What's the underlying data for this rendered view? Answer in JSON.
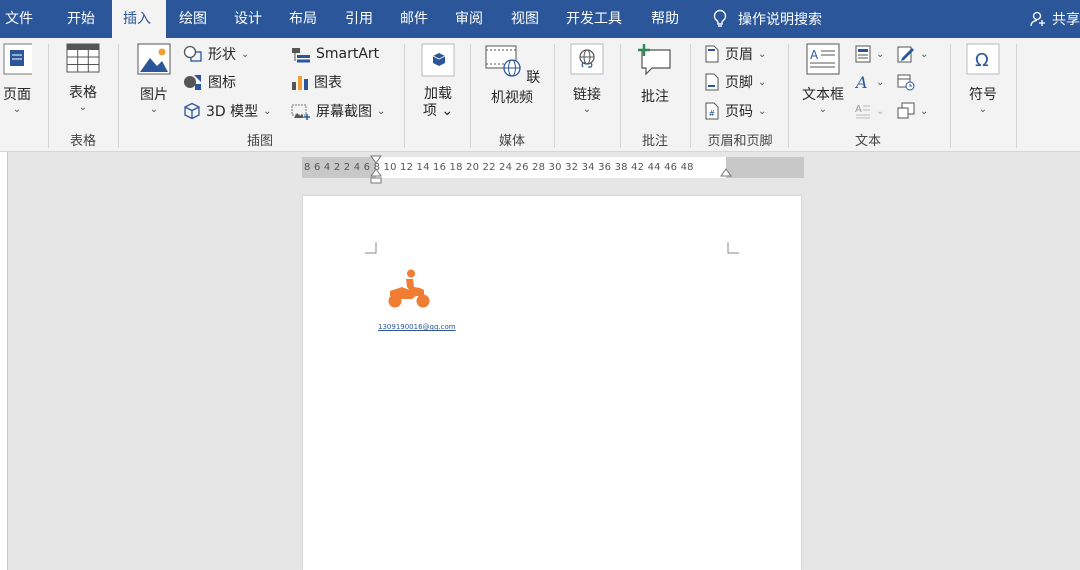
{
  "menu": {
    "tabs": [
      "文件",
      "开始",
      "插入",
      "绘图",
      "设计",
      "布局",
      "引用",
      "邮件",
      "审阅",
      "视图",
      "开发工具",
      "帮助"
    ],
    "active_tab": "插入",
    "search_label": "操作说明搜索",
    "share_label": "共享"
  },
  "ribbon": {
    "groups": {
      "page": {
        "button": "页面"
      },
      "table": {
        "button": "表格",
        "label": "表格"
      },
      "illustrations": {
        "label": "插图",
        "picture": "图片",
        "shapes": "形状",
        "icons": "图标",
        "model3d": "3D 模型",
        "smartart": "SmartArt",
        "chart": "图表",
        "screenshot": "屏幕截图"
      },
      "addins": {
        "button_line1": "加载",
        "button_line2": "项"
      },
      "media": {
        "button": "联机视频",
        "label": "媒体"
      },
      "links": {
        "button": "链接"
      },
      "comments": {
        "button": "批注",
        "label": "批注"
      },
      "header_footer": {
        "header": "页眉",
        "footer": "页脚",
        "page_number": "页码",
        "label": "页眉和页脚"
      },
      "text": {
        "textbox": "文本框",
        "label": "文本"
      },
      "symbols": {
        "button": "符号"
      }
    }
  },
  "ruler": {
    "numbers": "8   6   4   2          2    4    6    8   10  12  14  16  18  20  22  24  26  28  30  32  34  36  38        42  44  46  48"
  },
  "document": {
    "email": "1309190016@qq.com",
    "logo_icon": "motorcycle-icon",
    "logo_color": "#f07d32"
  },
  "colors": {
    "accent": "#2b579a",
    "ribbon_bg": "#f3f3f3"
  }
}
